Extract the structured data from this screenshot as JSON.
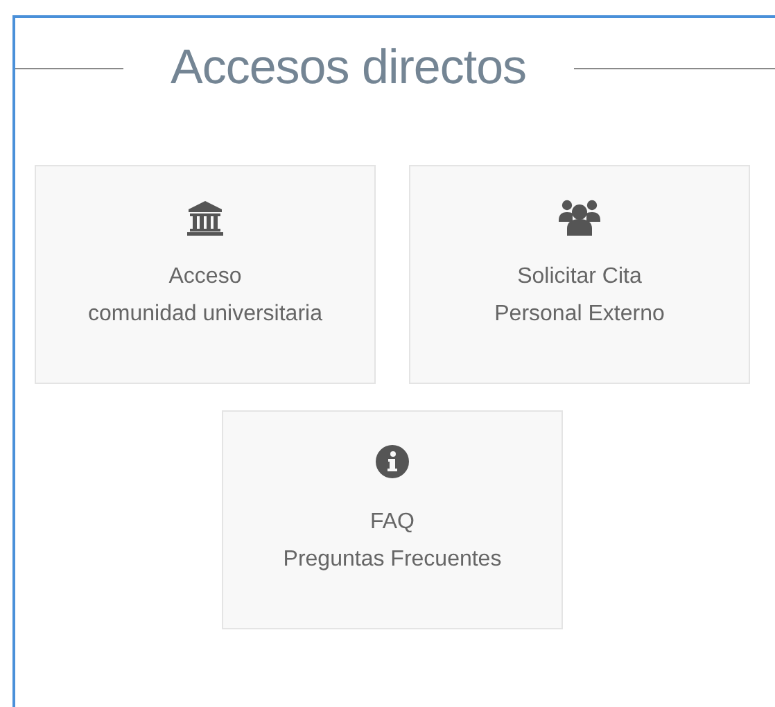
{
  "section": {
    "title": "Accesos directos"
  },
  "shortcuts": [
    {
      "kind": "institution",
      "lines": [
        "Acceso",
        "comunidad universitaria"
      ]
    },
    {
      "kind": "group",
      "lines": [
        "Solicitar Cita",
        "Personal Externo"
      ]
    },
    {
      "kind": "info",
      "lines": [
        "FAQ",
        "Preguntas Frecuentes"
      ]
    }
  ]
}
